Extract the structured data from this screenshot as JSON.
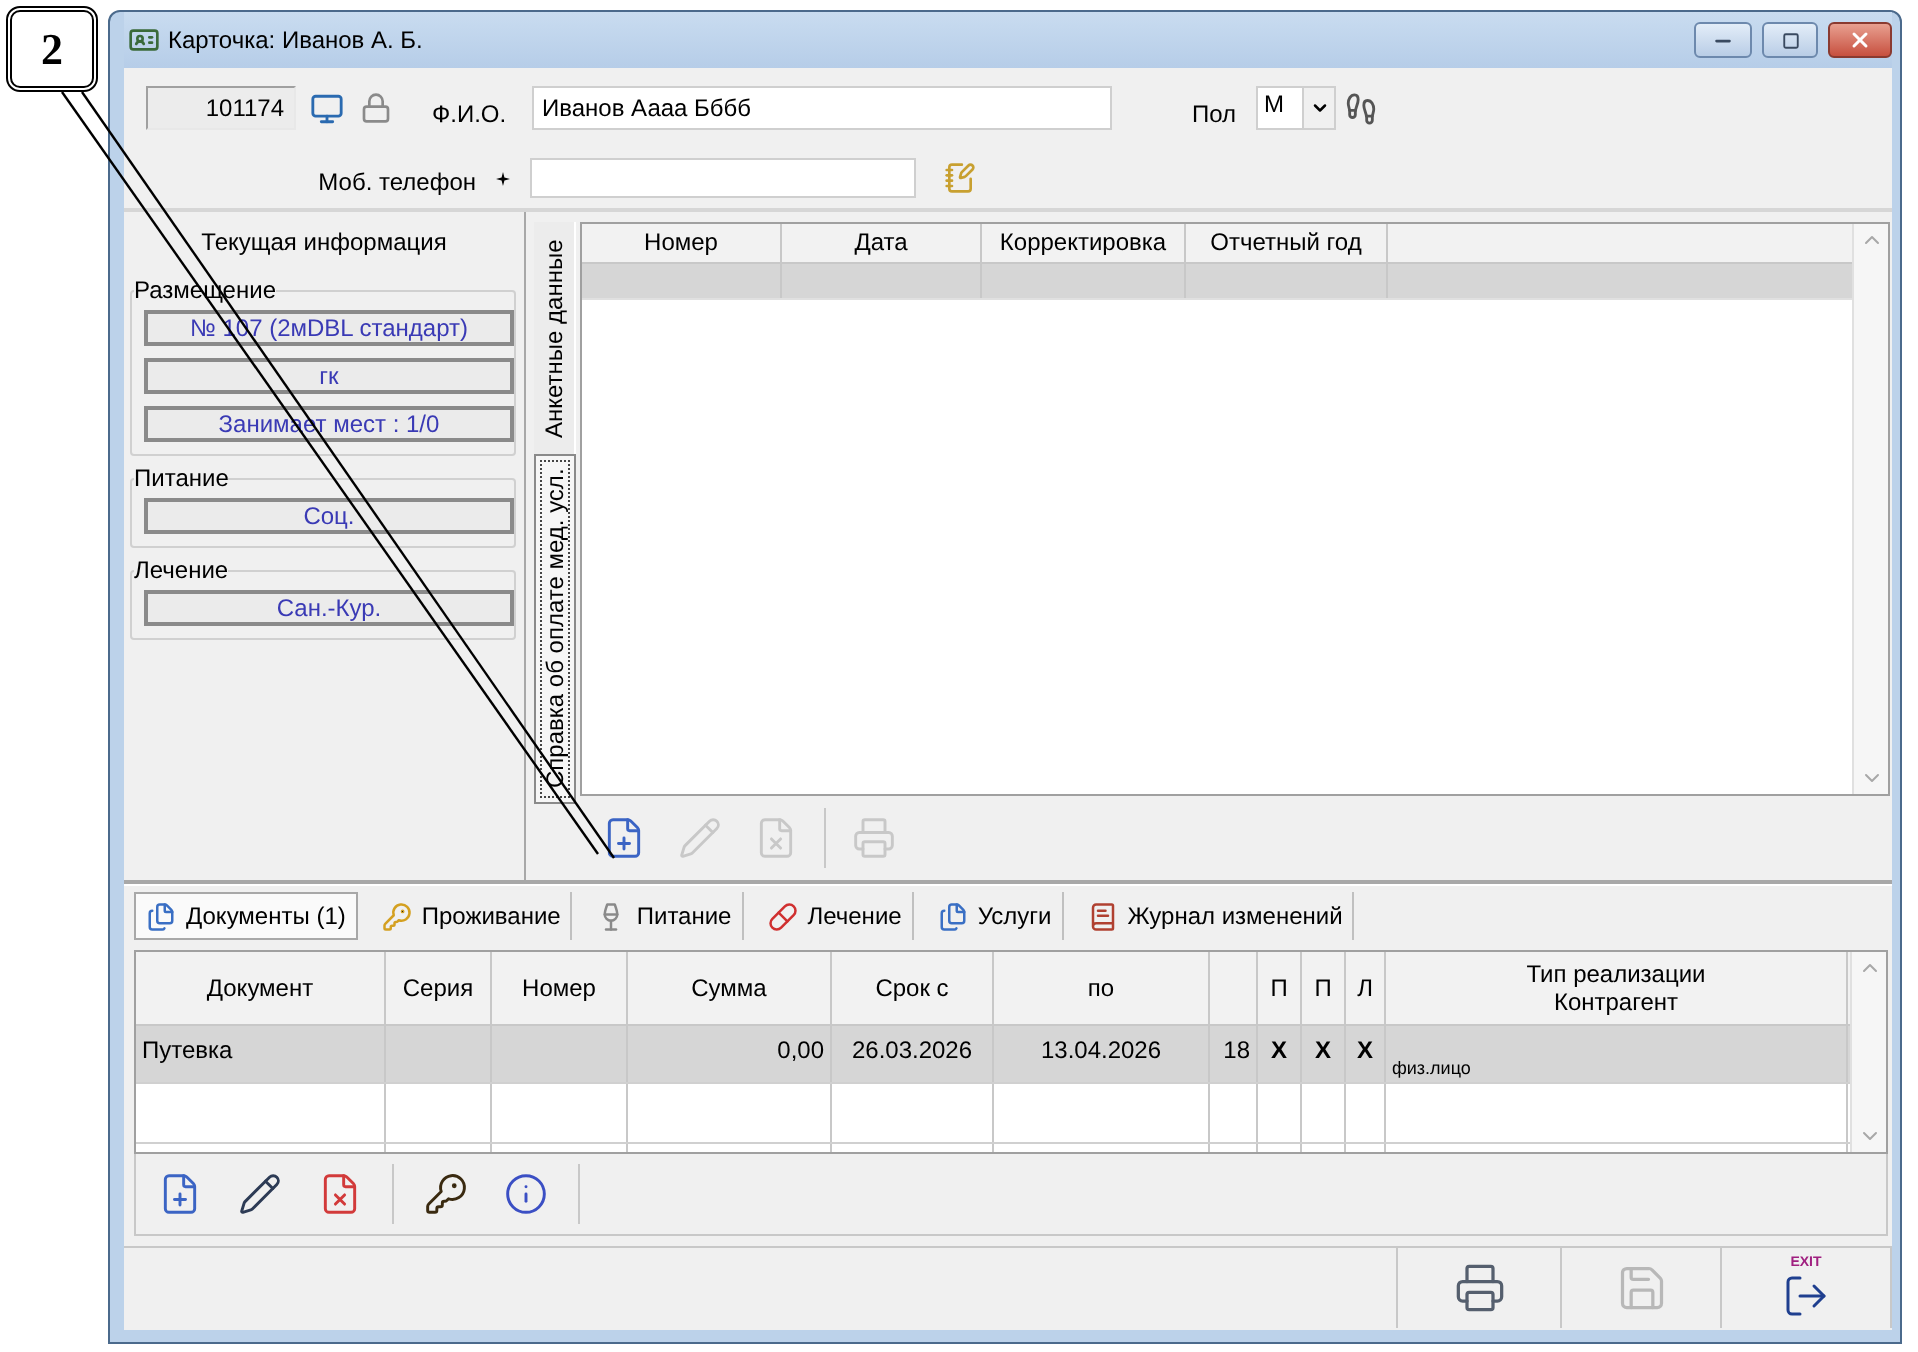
{
  "callout": {
    "label": "2"
  },
  "window": {
    "title": "Карточка: Иванов А. Б."
  },
  "header": {
    "record_id": "101174",
    "name_label": "Ф.И.О.",
    "name_value": "Иванов Аааа Бббб",
    "sex_label": "Пол",
    "sex_value": "М",
    "phone_label": "Моб. телефон"
  },
  "current_info": {
    "title": "Текущая информация",
    "groups": [
      {
        "label": "Размещение",
        "fields": [
          "№ 107 (2мDBL стандарт)",
          "гк",
          "Занимает мест : 1/0"
        ]
      },
      {
        "label": "Питание",
        "fields": [
          "Соц."
        ]
      },
      {
        "label": "Лечение",
        "fields": [
          "Сан.-Кур."
        ]
      }
    ]
  },
  "side_tabs": [
    {
      "label": "Анкетные данные",
      "selected": false
    },
    {
      "label": "Справка об оплате мед. усл.",
      "selected": true
    }
  ],
  "certificates_table": {
    "columns": [
      "Номер",
      "Дата",
      "Корректировка",
      "Отчетный год"
    ],
    "rows": [
      {
        "selected": true
      }
    ]
  },
  "certificates_toolbar": [
    {
      "kind": "new",
      "disabled": false
    },
    {
      "kind": "edit",
      "disabled": true
    },
    {
      "kind": "delete",
      "disabled": true
    },
    {
      "kind": "print",
      "disabled": true
    }
  ],
  "bottom_tabs": [
    {
      "kind": "documents",
      "label": "Документы (1)",
      "selected": true
    },
    {
      "kind": "accommodation",
      "label": "Проживание",
      "selected": false
    },
    {
      "kind": "food",
      "label": "Питание",
      "selected": false
    },
    {
      "kind": "treatment",
      "label": "Лечение",
      "selected": false
    },
    {
      "kind": "services",
      "label": "Услуги",
      "selected": false
    },
    {
      "kind": "log",
      "label": "Журнал изменений",
      "selected": false
    }
  ],
  "documents_table": {
    "columns": [
      {
        "label": "Документ"
      },
      {
        "label": "Серия"
      },
      {
        "label": "Номер"
      },
      {
        "label": "Сумма"
      },
      {
        "label": "Срок с"
      },
      {
        "label": "по"
      },
      {},
      {
        "label": "П"
      },
      {
        "label": "П"
      },
      {
        "label": "Л"
      },
      {
        "label": "Тип реализации",
        "sublabel": "Контрагент"
      }
    ],
    "rows": [
      {
        "selected": true,
        "cells": [
          "Путевка",
          null,
          null,
          "0,00",
          "26.03.2026",
          "13.04.2026",
          "18",
          "X",
          "X",
          "X",
          "физ.лицо"
        ]
      }
    ]
  },
  "documents_toolbar": [
    {
      "kind": "new",
      "disabled": false
    },
    {
      "kind": "edit",
      "disabled": false
    },
    {
      "kind": "delete",
      "disabled": false
    },
    {
      "kind": "keys",
      "disabled": false
    },
    {
      "kind": "info",
      "disabled": false
    }
  ],
  "status_bar": [
    {
      "kind": "print",
      "disabled": false
    },
    {
      "kind": "save",
      "disabled": true
    },
    {
      "kind": "exit",
      "disabled": false,
      "label": "EXIT"
    }
  ]
}
